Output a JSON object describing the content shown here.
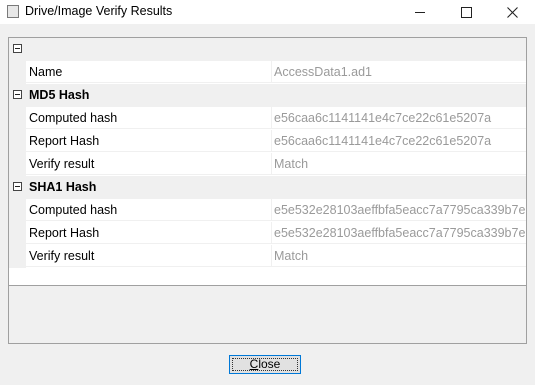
{
  "window": {
    "title": "Drive/Image Verify Results",
    "icon": "app-window-icon"
  },
  "grid": {
    "top_category": {
      "label": ""
    },
    "rows_top": [
      {
        "name": "Name",
        "value": "AccessData1.ad1"
      }
    ],
    "md5": {
      "label": "MD5 Hash",
      "rows": [
        {
          "name": "Computed hash",
          "value": "e56caa6c1141141e4c7ce22c61e5207a"
        },
        {
          "name": "Report Hash",
          "value": "e56caa6c1141141e4c7ce22c61e5207a"
        },
        {
          "name": "Verify result",
          "value": "Match"
        }
      ]
    },
    "sha1": {
      "label": "SHA1 Hash",
      "rows": [
        {
          "name": "Computed hash",
          "value": "e5e532e28103aeffbfa5eacc7a7795ca339b7e"
        },
        {
          "name": "Report Hash",
          "value": "e5e532e28103aeffbfa5eacc7a7795ca339b7e"
        },
        {
          "name": "Verify result",
          "value": "Match"
        }
      ]
    }
  },
  "footer": {
    "close_first": "C",
    "close_rest": "lose"
  },
  "colors": {
    "value_text": "#9a9a9a",
    "accent_border": "#0078d7"
  }
}
